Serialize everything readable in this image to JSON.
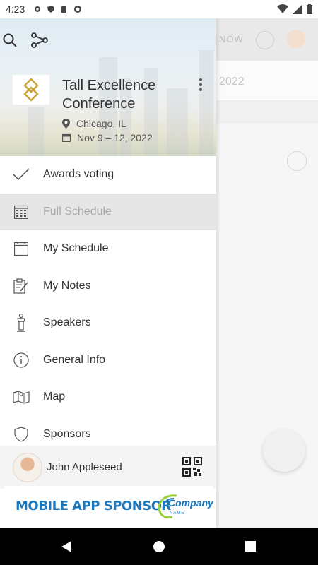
{
  "status_bar": {
    "time": "4:23"
  },
  "background_app": {
    "now_label": "NOW",
    "year_text": "2022"
  },
  "drawer": {
    "conference": {
      "title": "Tall Excellence Conference",
      "location": "Chicago, IL",
      "dates": "Nov 9 – 12, 2022"
    },
    "menu": [
      {
        "label": "Awards voting",
        "icon": "checkmark-icon"
      },
      {
        "label": "Full Schedule",
        "icon": "calendar-grid-icon",
        "active": true
      },
      {
        "label": "My Schedule",
        "icon": "calendar-icon"
      },
      {
        "label": "My Notes",
        "icon": "notes-icon"
      },
      {
        "label": "Speakers",
        "icon": "podium-icon"
      },
      {
        "label": "General Info",
        "icon": "info-icon"
      },
      {
        "label": "Map",
        "icon": "map-icon"
      },
      {
        "label": "Sponsors",
        "icon": "shield-icon"
      }
    ],
    "user": {
      "name": "John Appleseed"
    },
    "sponsor_banner": {
      "text": "MOBILE APP SPONSOR",
      "company": "Company",
      "company_sub": "NAME"
    }
  },
  "colors": {
    "sponsor_blue": "#1b78bd",
    "logo_gold": "#c9a437",
    "active_bg": "#e6e6e6"
  }
}
